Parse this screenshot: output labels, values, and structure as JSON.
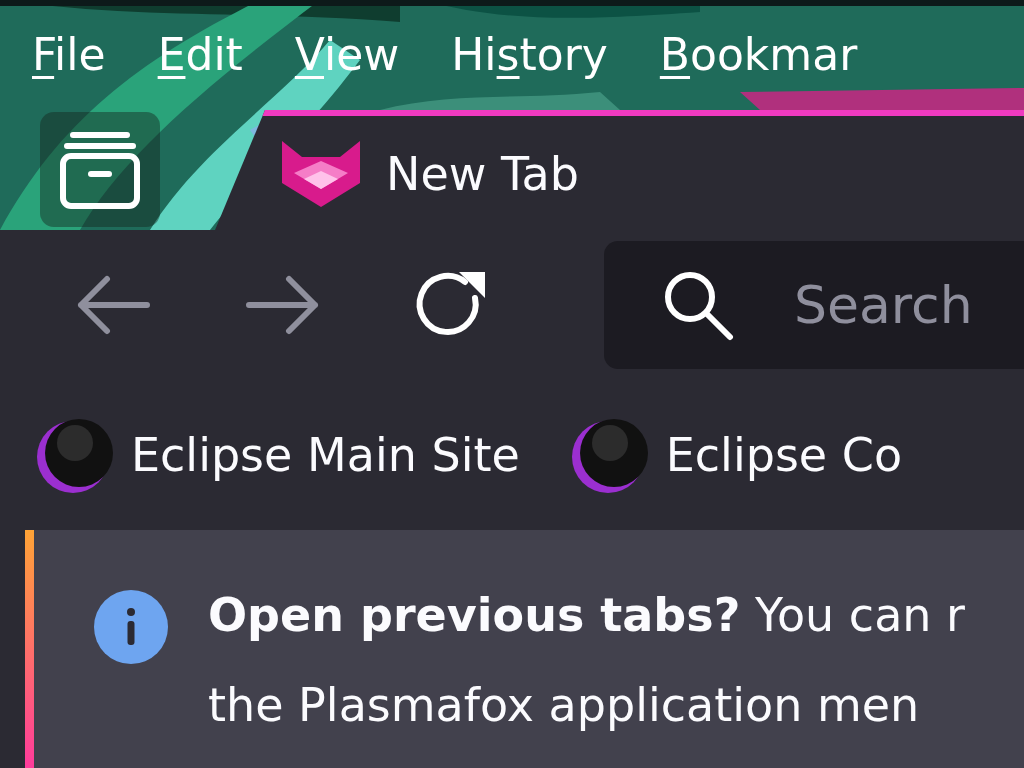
{
  "menu_bar": [
    {
      "key": "F",
      "post": "ile"
    },
    {
      "key": "E",
      "post": "dit"
    },
    {
      "key": "V",
      "post": "iew"
    },
    {
      "pre": "Hi",
      "key": "s",
      "post": "tory"
    },
    {
      "key": "B",
      "post": "ookmar"
    }
  ],
  "tabs": [
    {
      "label": "New Tab",
      "selected": true
    }
  ],
  "toolbar": {
    "back_disabled": true,
    "forward_disabled": true,
    "search": {
      "placeholder": "Search"
    }
  },
  "bookmarks": [
    {
      "label": "Eclipse Main Site"
    },
    {
      "label": "Eclipse Co"
    }
  ],
  "notification": {
    "lines": [
      "**Open previous tabs?** You can r",
      "the Plasmafox application men"
    ]
  }
}
